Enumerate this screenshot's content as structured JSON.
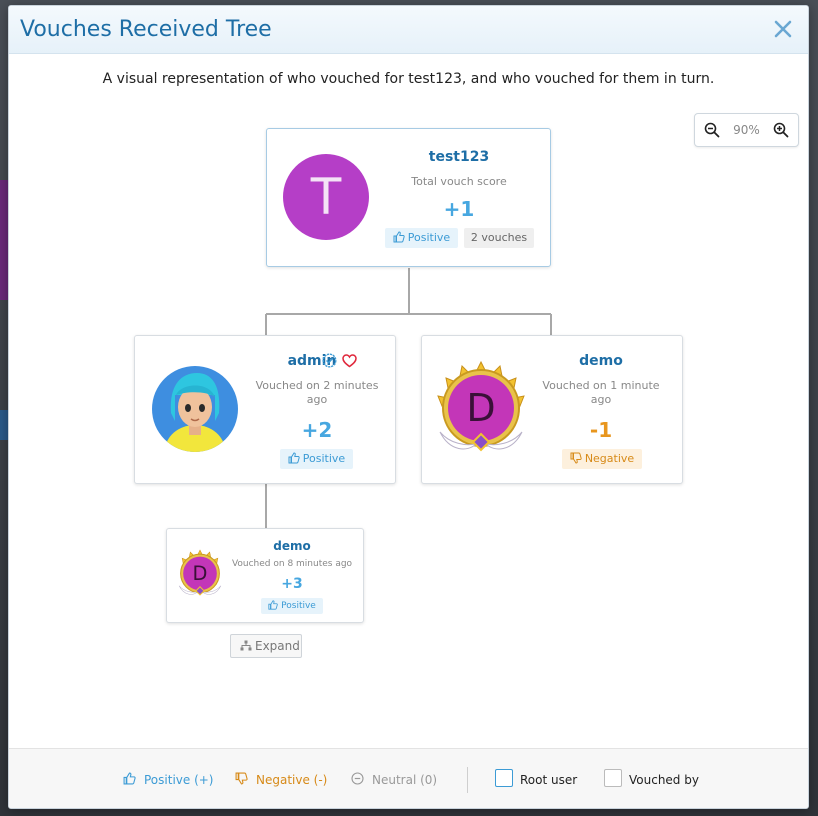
{
  "dialog": {
    "title": "Vouches Received Tree",
    "description": "A visual representation of who vouched for test123, and who vouched for them in turn."
  },
  "zoom": {
    "level": "90%"
  },
  "tree": {
    "root": {
      "username": "test123",
      "avatar_letter": "T",
      "score_label": "Total vouch score",
      "score": "+1",
      "badge": "Positive",
      "count": "2 vouches"
    },
    "children": [
      {
        "username": "admin",
        "meta": "Vouched on 2 minutes ago",
        "score": "+2",
        "badge": "Positive"
      },
      {
        "username": "demo",
        "avatar_letter": "D",
        "meta": "Vouched on 1 minute ago",
        "score": "-1",
        "badge": "Negative"
      }
    ],
    "grandchild": {
      "username": "demo",
      "avatar_letter": "D",
      "meta": "Vouched on 8 minutes ago",
      "score": "+3",
      "badge": "Positive"
    },
    "expand_label": "Expand"
  },
  "legend": {
    "positive": "Positive (+)",
    "negative": "Negative (-)",
    "neutral": "Neutral (0)",
    "root_user": "Root user",
    "vouched_by": "Vouched by"
  },
  "colors": {
    "accent": "#1e6ea6",
    "positive": "#47a7e0",
    "negative": "#e8961e",
    "avatar": "#b53ec7"
  }
}
